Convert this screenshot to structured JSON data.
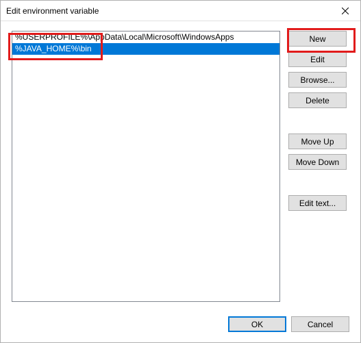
{
  "window": {
    "title": "Edit environment variable"
  },
  "list": {
    "items": [
      {
        "text": "%USERPROFILE%\\AppData\\Local\\Microsoft\\WindowsApps",
        "selected": false
      },
      {
        "text": "%JAVA_HOME%\\bin",
        "selected": true
      }
    ]
  },
  "buttons": {
    "new": "New",
    "edit": "Edit",
    "browse": "Browse...",
    "delete": "Delete",
    "moveUp": "Move Up",
    "moveDown": "Move Down",
    "editText": "Edit text...",
    "ok": "OK",
    "cancel": "Cancel"
  }
}
